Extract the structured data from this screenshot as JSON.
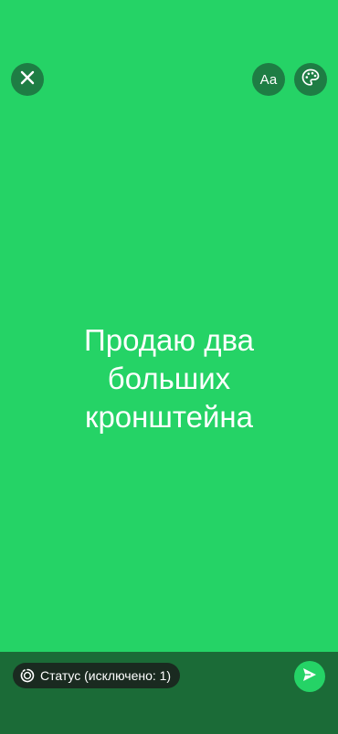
{
  "colors": {
    "background": "#25d366",
    "button_bg": "#1e7d44",
    "bottom_bar": "#1b6b37",
    "chip_bg": "#1a2a20",
    "send_bg": "#25d366"
  },
  "toolbar": {
    "close_icon": "close-icon",
    "font_label": "Aa",
    "palette_icon": "palette-icon"
  },
  "status": {
    "text": "Продаю два больших кронштейна"
  },
  "footer": {
    "audience_label": "Статус (исключено: 1)",
    "audience_icon": "status-ring-icon",
    "send_icon": "send-icon"
  }
}
